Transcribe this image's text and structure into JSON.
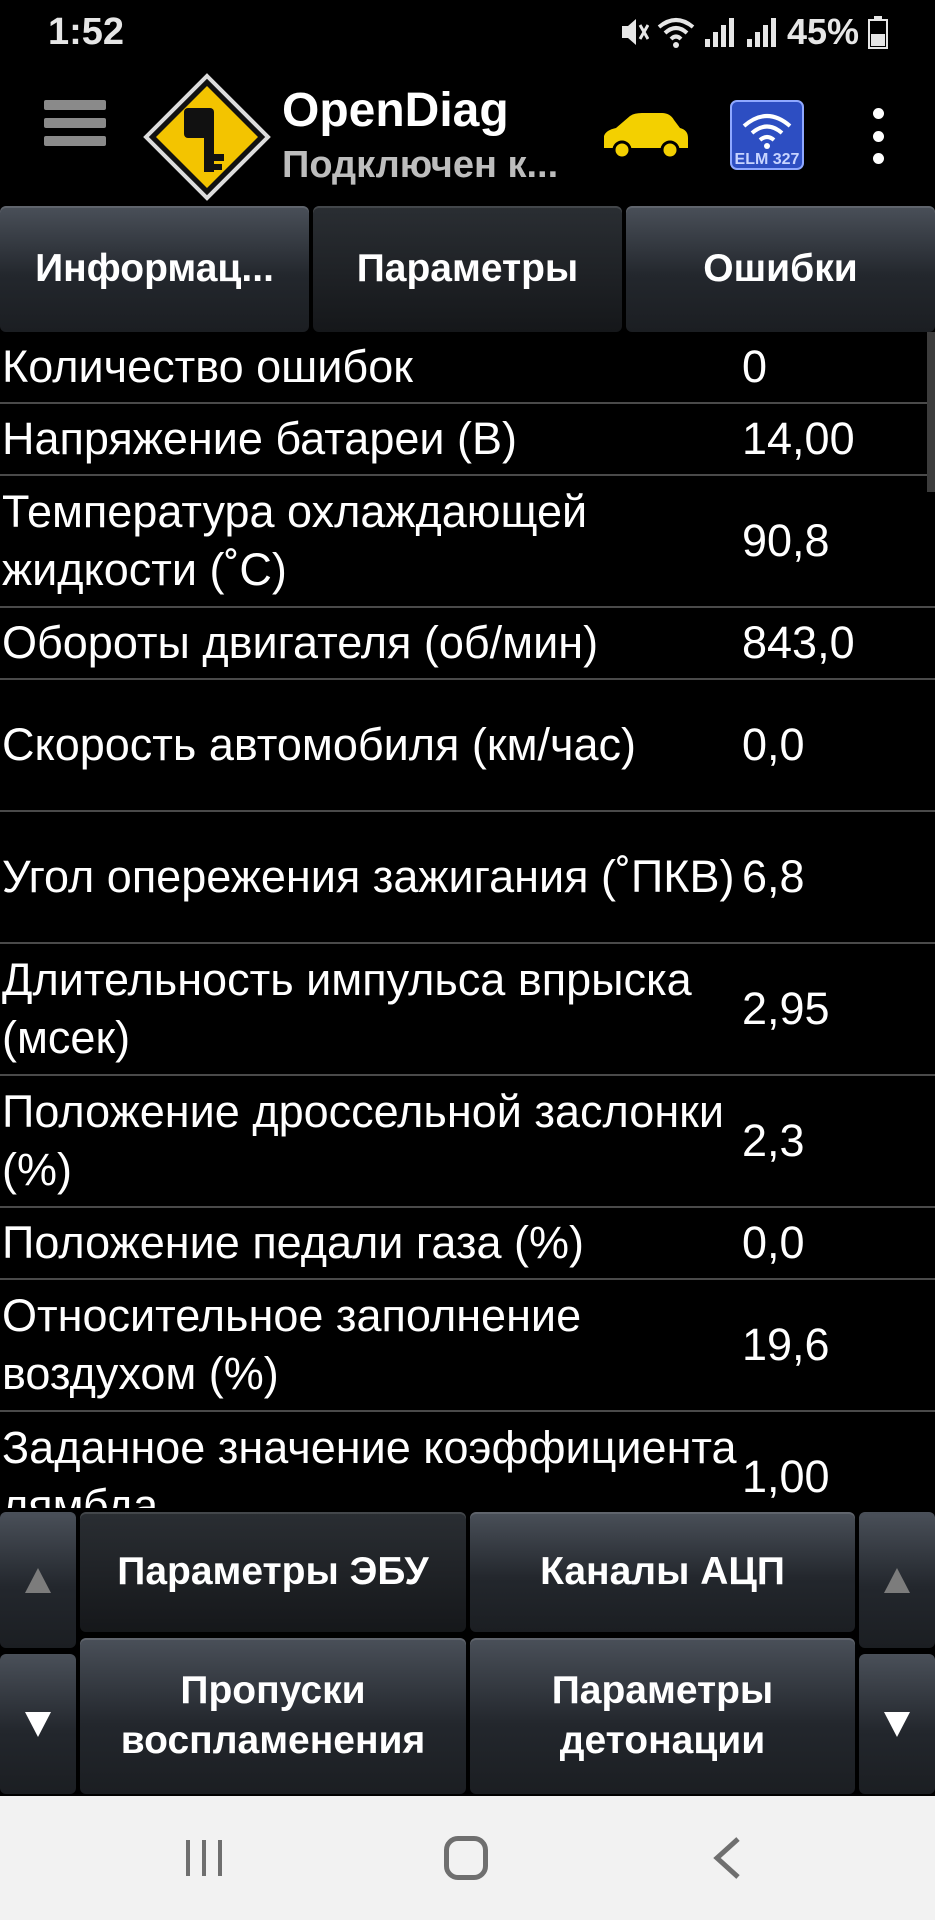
{
  "status": {
    "time": "1:52",
    "battery": "45%"
  },
  "appbar": {
    "title": "OpenDiag",
    "subtitle": "Подключен к...",
    "elm_label": "ELM 327"
  },
  "tabs": [
    {
      "label": "Информац..."
    },
    {
      "label": "Параметры"
    },
    {
      "label": "Ошибки"
    }
  ],
  "params": [
    {
      "name": "Количество ошибок",
      "value": "0"
    },
    {
      "name": "Напряжение батареи (В)",
      "value": "14,00"
    },
    {
      "name": "Температура охлаждающей жидкости (˚С)",
      "value": "90,8"
    },
    {
      "name": "Обороты двигателя (об/мин)",
      "value": "843,0"
    },
    {
      "name": "Скорость автомобиля (км/час)",
      "value": "0,0"
    },
    {
      "name": "Угол опережения зажигания (˚ПКВ)",
      "value": "6,8"
    },
    {
      "name": "Длительность импульса впрыска (мсек)",
      "value": "2,95"
    },
    {
      "name": "Положение дроссельной заслонки (%)",
      "value": "2,3"
    },
    {
      "name": "Положение педали газа (%)",
      "value": "0,0"
    },
    {
      "name": "Относительное заполнение воздухом (%)",
      "value": "19,6"
    },
    {
      "name": "Заданное значение коэффициента лямбда",
      "value": "1,00"
    }
  ],
  "bottom_buttons": {
    "ecu_params": "Параметры ЭБУ",
    "adc_channels": "Каналы АЦП",
    "misfires": "Пропуски воспламенения",
    "knock_params": "Параметры детонации"
  }
}
